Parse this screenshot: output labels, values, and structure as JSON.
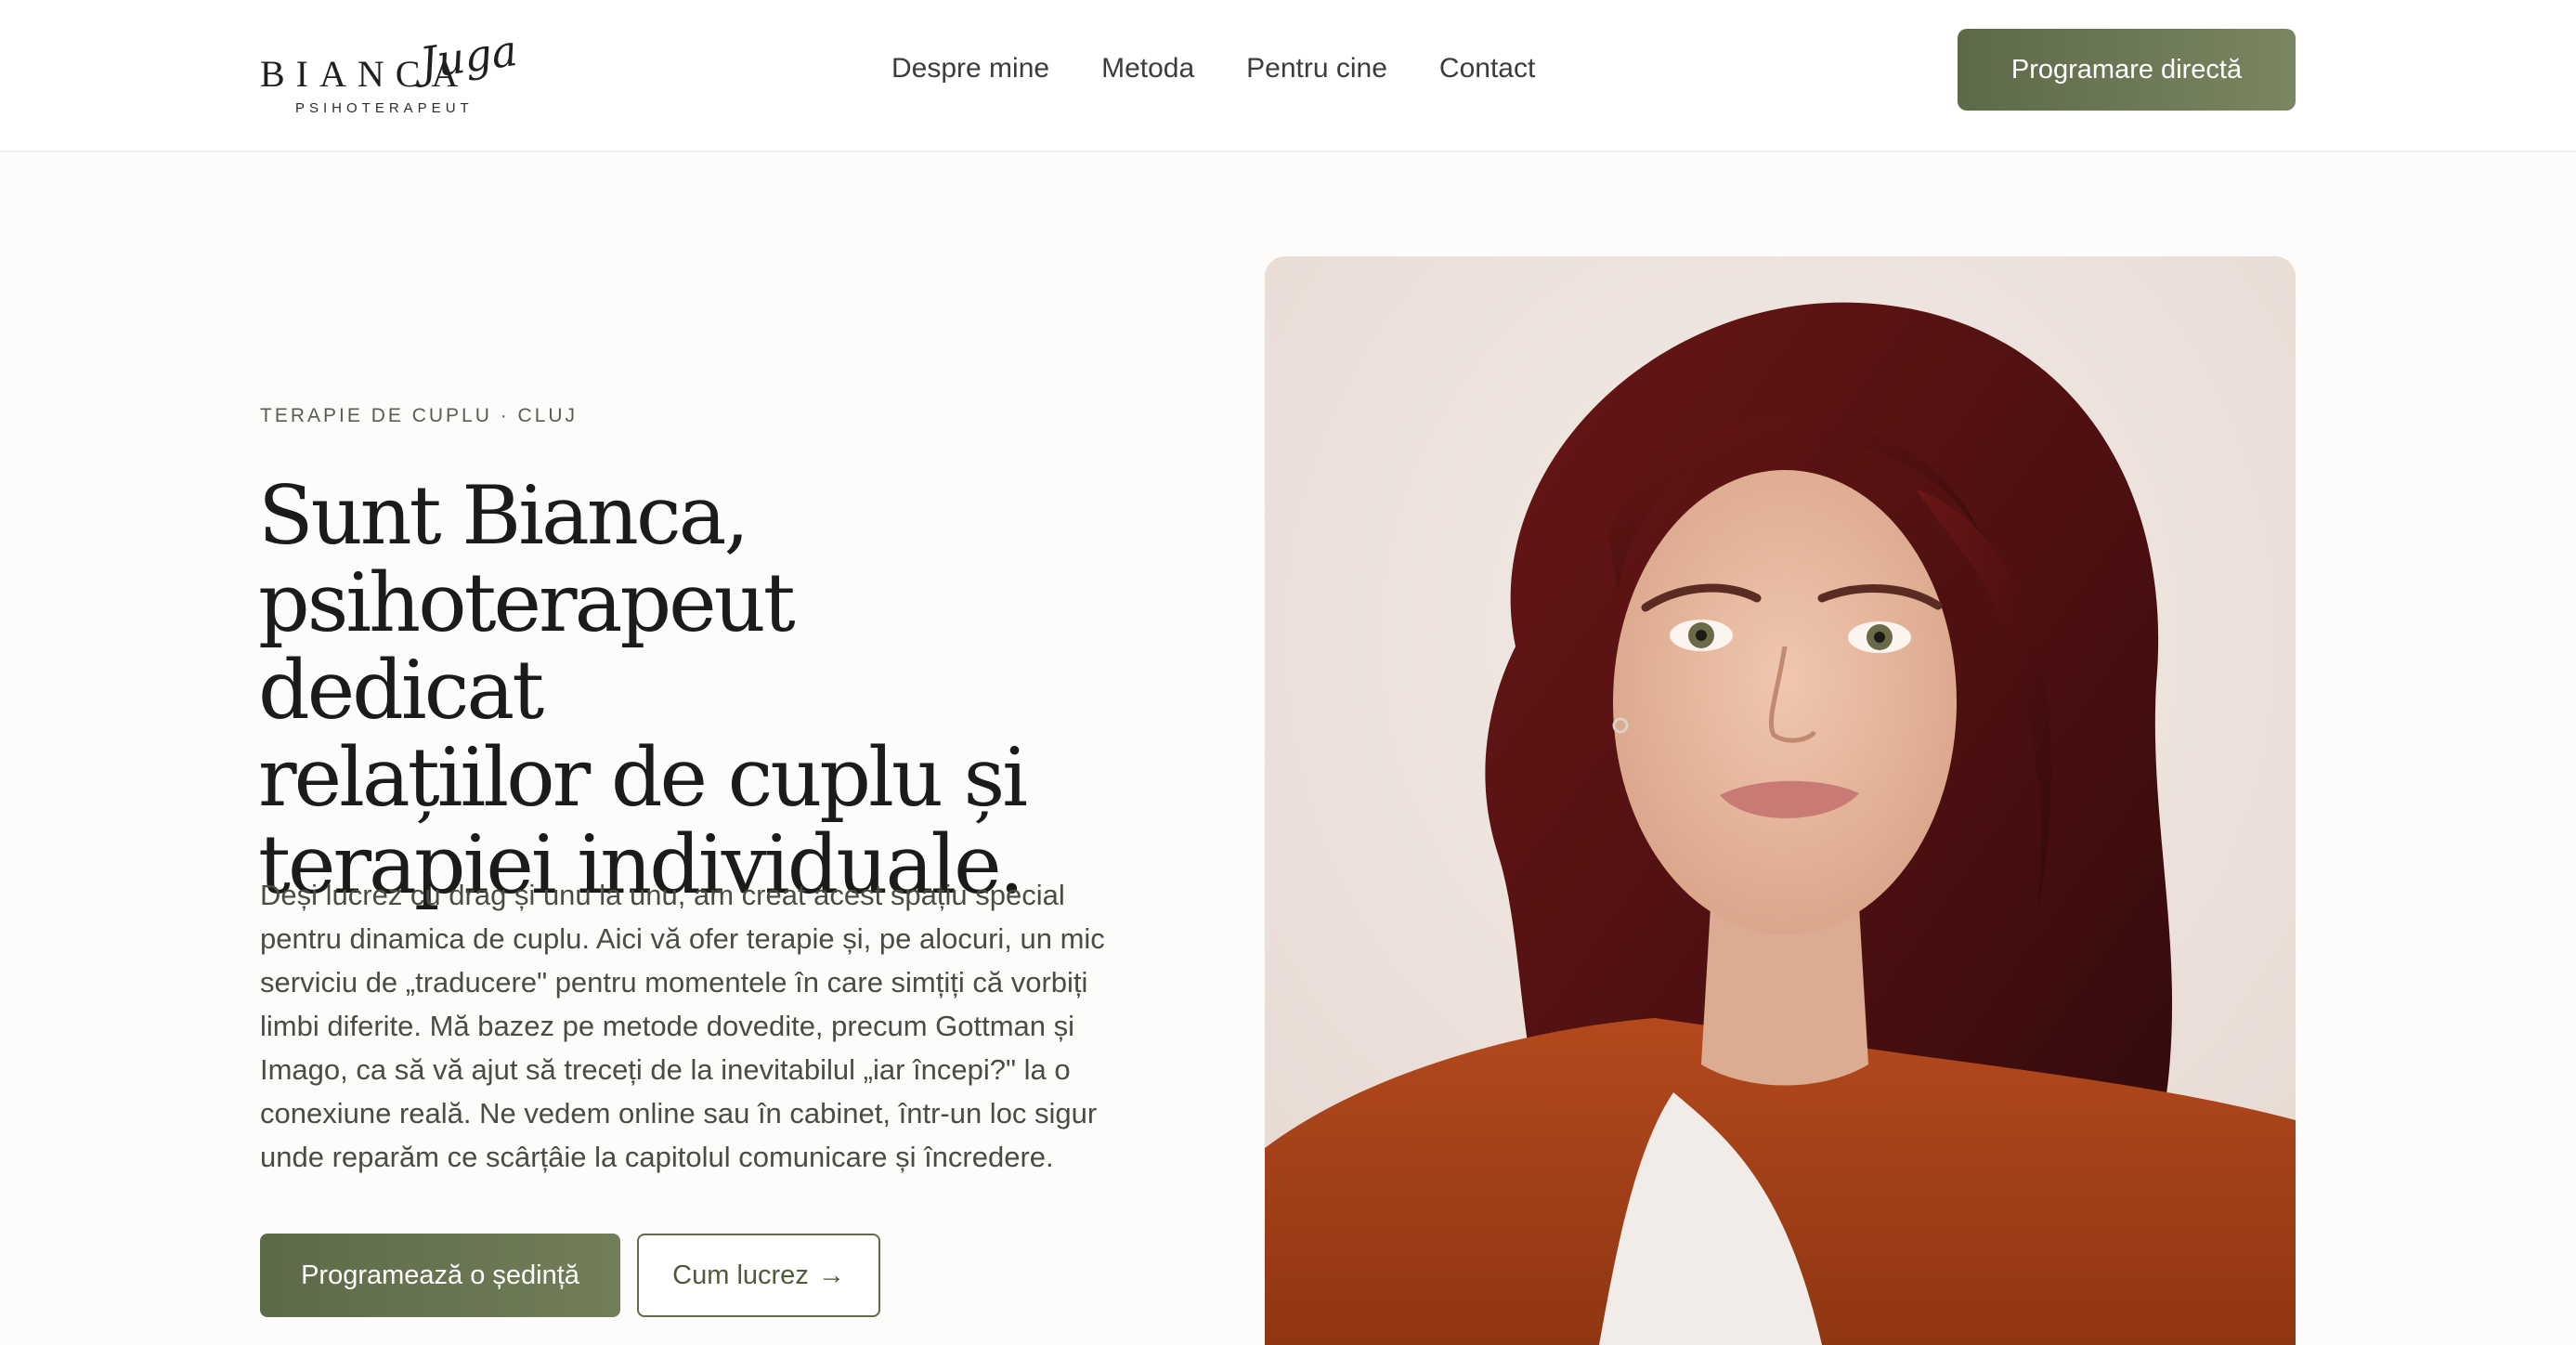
{
  "header": {
    "logo": {
      "first_name": "BIANCA",
      "last_name": "Juga",
      "subtitle": "PSIHOTERAPEUT"
    },
    "nav": [
      {
        "label": "Despre mine"
      },
      {
        "label": "Metoda"
      },
      {
        "label": "Pentru cine"
      },
      {
        "label": "Contact"
      }
    ],
    "cta_label": "Programare directă"
  },
  "hero": {
    "eyebrow": "TERAPIE DE CUPLU · CLUJ",
    "headline_lines": [
      "Sunt Bianca,",
      "psihoterapeut dedicat",
      "relațiilor de cuplu și",
      "terapiei individuale."
    ],
    "intro_lines": [
      "Deși lucrez cu drag și unu la unu, am creat acest spațiu special",
      "pentru dinamica de cuplu. Aici vă ofer terapie și, pe alocuri, un mic",
      "serviciu de „traducere\" pentru momentele în care simțiți că vorbiți",
      "limbi diferite. Mă bazez pe metode dovedite, precum Gottman și",
      "Imago, ca să vă ajut să treceți de la inevitabilul „iar începi?\" la o",
      "conexiune reală. Ne vedem online sau în cabinet, într-un loc sigur",
      "unde reparăm ce scârțâie la capitolul comunicare și încredere."
    ],
    "primary_button": "Programează o ședință",
    "secondary_button": "Cum lucrez",
    "secondary_arrow": "→"
  },
  "colors": {
    "accent": "#66724f",
    "background": "#fdfcfb",
    "text": "#1b1b1a"
  }
}
